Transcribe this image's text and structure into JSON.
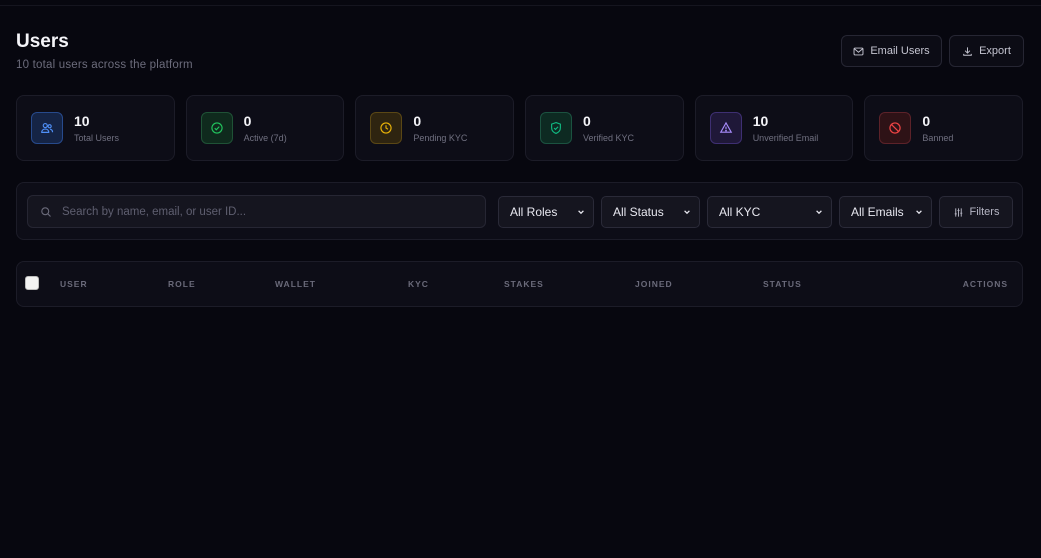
{
  "header": {
    "title": "Users",
    "subtitle": "10 total users across the platform",
    "email_button": "Email Users",
    "export_button": "Export"
  },
  "stats": [
    {
      "value": "10",
      "label": "Total Users",
      "icon": "users-icon",
      "color": "#3b82f6"
    },
    {
      "value": "0",
      "label": "Active (7d)",
      "icon": "check-circle-icon",
      "color": "#22c55e"
    },
    {
      "value": "0",
      "label": "Pending KYC",
      "icon": "clock-icon",
      "color": "#eab308"
    },
    {
      "value": "0",
      "label": "Verified KYC",
      "icon": "shield-check-icon",
      "color": "#10b981"
    },
    {
      "value": "10",
      "label": "Unverified Email",
      "icon": "alert-triangle-icon",
      "color": "#8b5cf6"
    },
    {
      "value": "0",
      "label": "Banned",
      "icon": "ban-icon",
      "color": "#ef4444"
    }
  ],
  "filters": {
    "search_placeholder": "Search by name, email, or user ID...",
    "role": "All Roles",
    "status": "All Status",
    "kyc": "All KYC",
    "emails": "All Emails",
    "filters_button": "Filters"
  },
  "table": {
    "columns": [
      "USER",
      "ROLE",
      "WALLET",
      "KYC",
      "STAKES",
      "JOINED",
      "STATUS",
      "ACTIONS"
    ]
  }
}
